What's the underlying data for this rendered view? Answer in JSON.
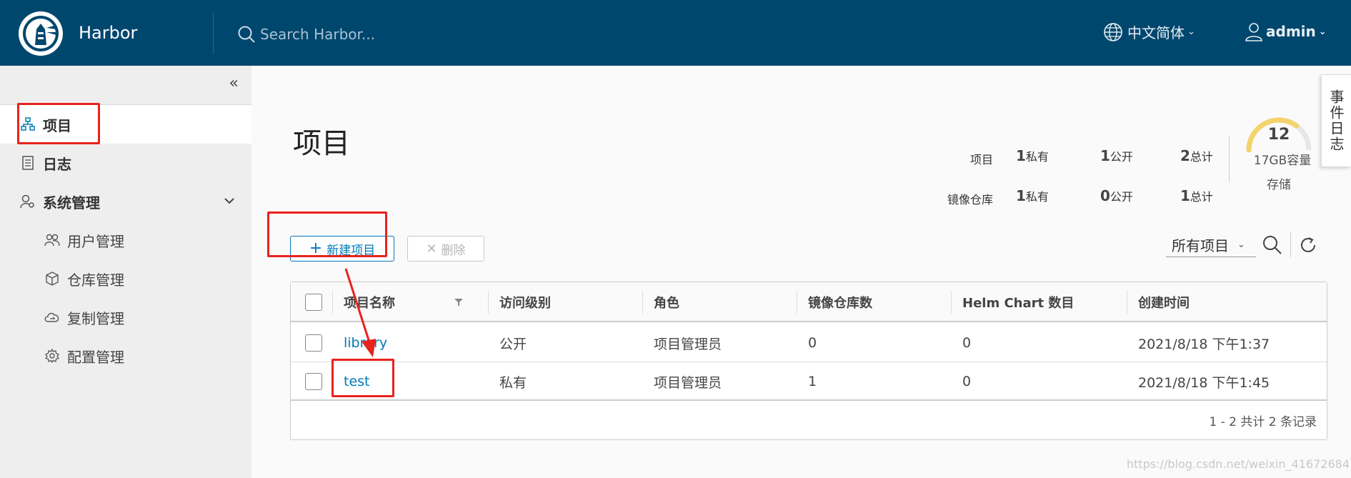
{
  "header": {
    "app_title": "Harbor",
    "search_placeholder": "Search Harbor...",
    "language": "中文简体",
    "user": "admin"
  },
  "sidebar": {
    "items": [
      {
        "label": "项目"
      },
      {
        "label": "日志"
      },
      {
        "label": "系统管理"
      }
    ],
    "sub_items": [
      {
        "label": "用户管理"
      },
      {
        "label": "仓库管理"
      },
      {
        "label": "复制管理"
      },
      {
        "label": "配置管理"
      }
    ]
  },
  "main": {
    "title": "项目",
    "event_log_tab": "事件日志",
    "stats": {
      "projects": {
        "label": "项目",
        "private_count": "1",
        "private_label": "私有",
        "public_count": "1",
        "public_label": "公开",
        "total_count": "2",
        "total_label": "总计"
      },
      "repositories": {
        "label": "镜像仓库",
        "private_count": "1",
        "private_label": "私有",
        "public_count": "0",
        "public_label": "公开",
        "total_count": "1",
        "total_label": "总计"
      }
    },
    "storage": {
      "value": "12",
      "capacity": "17GB容量",
      "label": "存储",
      "gauge_fraction": 0.7,
      "gauge_color": "#f3d36b"
    },
    "toolbar": {
      "new_button": "新建项目",
      "delete_button": "删除",
      "filter_value": "所有项目"
    },
    "table": {
      "columns": [
        "项目名称",
        "访问级别",
        "角色",
        "镜像仓库数",
        "Helm Chart 数目",
        "创建时间"
      ],
      "rows": [
        {
          "name": "library",
          "access": "公开",
          "role": "项目管理员",
          "repos": "0",
          "charts": "0",
          "created": "2021/8/18 下午1:37"
        },
        {
          "name": "test",
          "access": "私有",
          "role": "项目管理员",
          "repos": "1",
          "charts": "0",
          "created": "2021/8/18 下午1:45"
        }
      ],
      "footer": "1 - 2 共计 2 条记录"
    }
  },
  "watermark": "https://blog.csdn.net/weixin_41672684",
  "colors": {
    "header_bg": "#00476e",
    "accent": "#0079b8",
    "annotation": "#e8221d"
  }
}
